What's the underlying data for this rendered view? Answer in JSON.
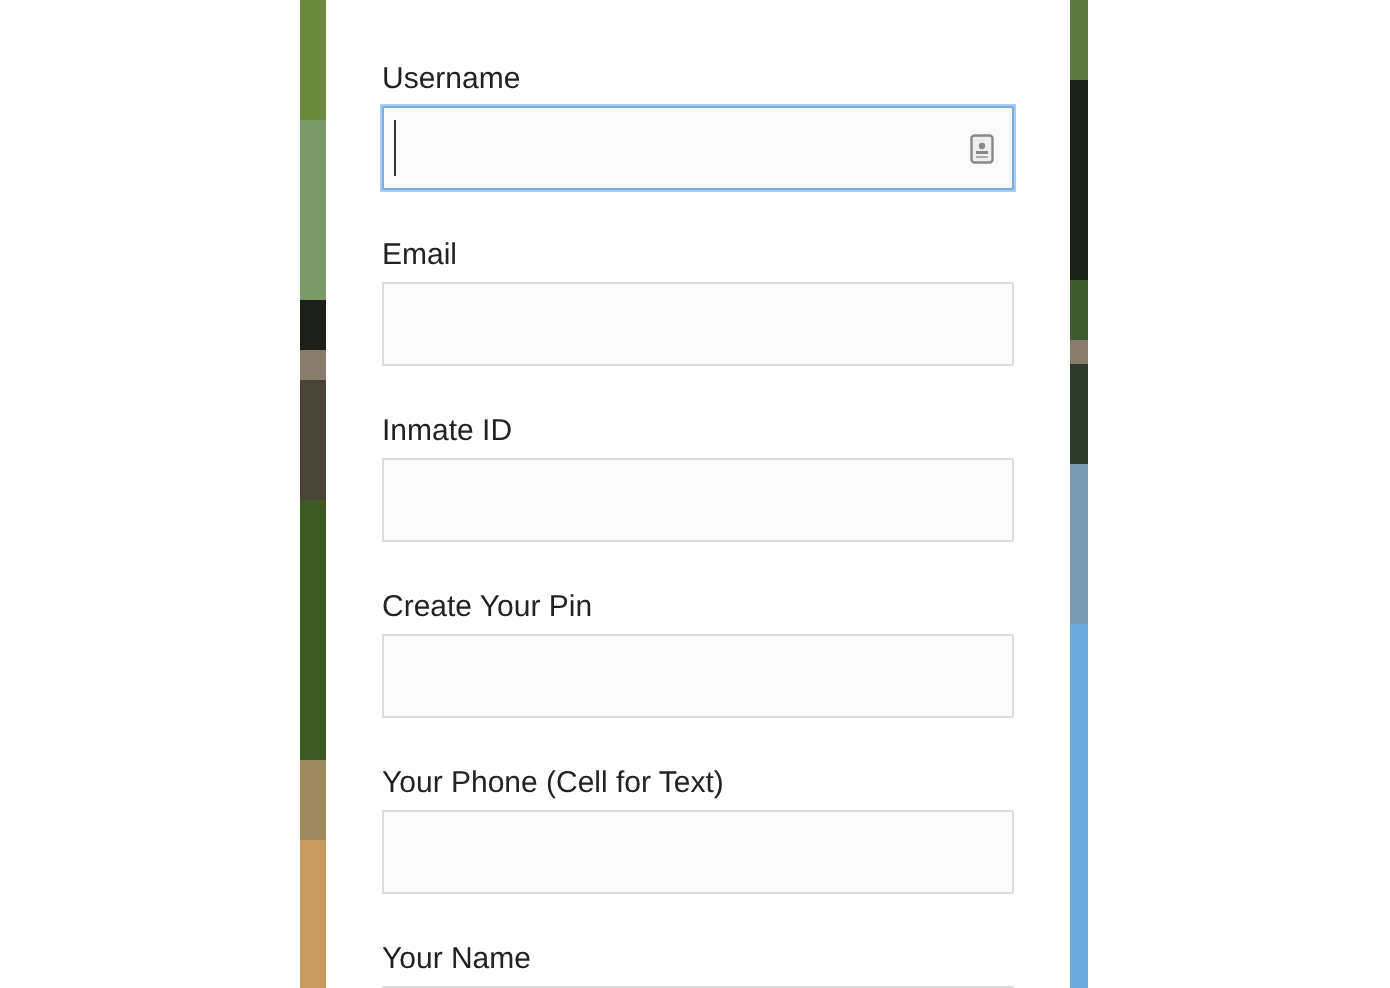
{
  "fields": [
    {
      "label": "Username",
      "focused": true,
      "autofill_icon": true
    },
    {
      "label": "Email",
      "focused": false,
      "autofill_icon": false
    },
    {
      "label": "Inmate ID",
      "focused": false,
      "autofill_icon": false
    },
    {
      "label": "Create Your Pin",
      "focused": false,
      "autofill_icon": false
    },
    {
      "label": "Your Phone (Cell for Text)",
      "focused": false,
      "autofill_icon": false
    },
    {
      "label": "Your Name"
    }
  ]
}
